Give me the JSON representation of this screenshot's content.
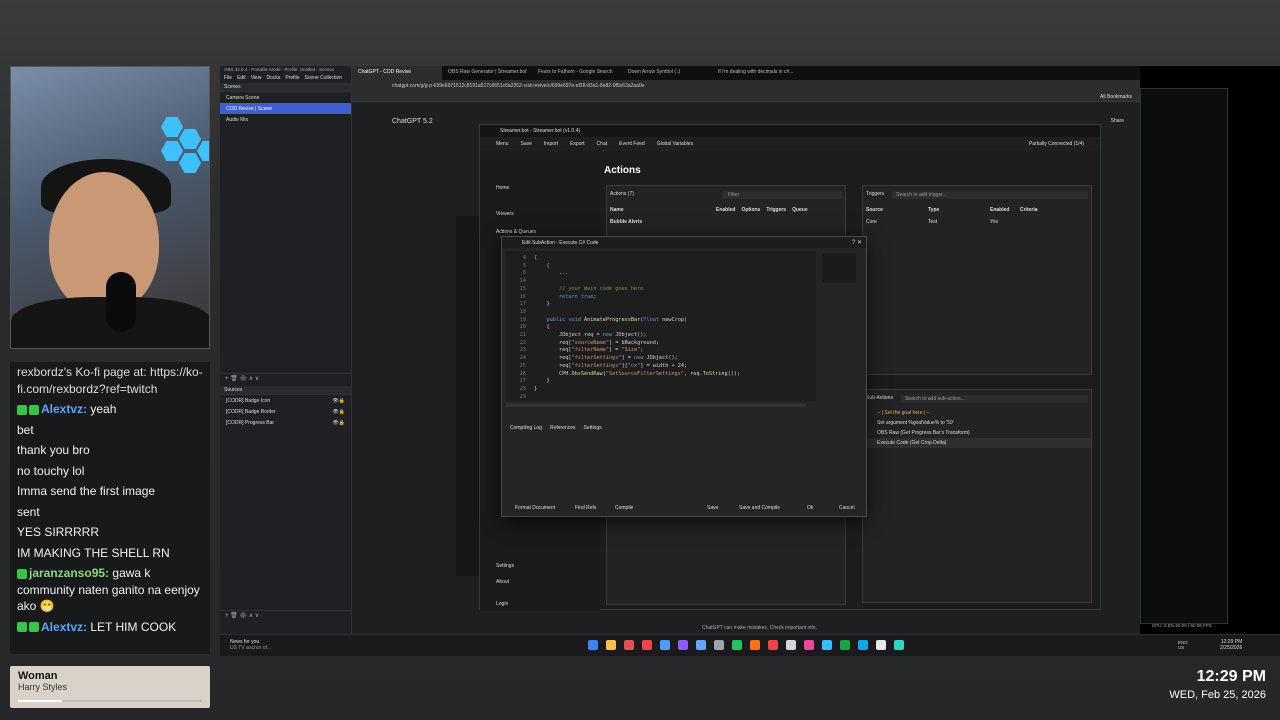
{
  "chat": {
    "messages": [
      {
        "user": "",
        "text": "rexbordz's Ko-fi page at: https://ko-fi.com/rexbordz?ref=twitch"
      },
      {
        "user": "Alextvz:",
        "text": "yeah"
      },
      {
        "user": "",
        "text": "bet"
      },
      {
        "user": "",
        "text": "thank you bro"
      },
      {
        "user": "",
        "text": "no touchy lol"
      },
      {
        "user": "",
        "text": "Imma send the first image"
      },
      {
        "user": "",
        "text": "sent"
      },
      {
        "user": "",
        "text": "YES SIRRRRR"
      },
      {
        "user": "",
        "text": "IM MAKING THE SHELL RN"
      },
      {
        "user": "jaranzanso95:",
        "text": "gawa k community naten ganito na eenjoy ako 😁"
      },
      {
        "user": "Alextvz:",
        "text": "LET HIM COOK"
      }
    ]
  },
  "now_playing": {
    "title": "Woman",
    "artist": "Harry Styles",
    "progress": 0.24
  },
  "clock": {
    "time": "12:29 PM",
    "date": "WED, Feb 25, 2026"
  },
  "obs": {
    "title": "OBS 32.0.4 - Portable Mode - Profile: Untitled - Scenes",
    "menu": [
      "File",
      "Edit",
      "View",
      "Docks",
      "Profile",
      "Scene Collection"
    ],
    "scenes_header": "Scenes",
    "scenes": [
      "Camera Scene",
      "COD Revive | Scene",
      "Audio Mix"
    ],
    "sources_header": "Sources",
    "sources": [
      "[CODR] Badge Icon",
      "[CODR] Badge Border",
      "[CODR] Progress Bar"
    ]
  },
  "browser": {
    "tabs": [
      "ChatGPT - COD Revive",
      "OBS Raw Generator | Streamer.bot",
      "Fears to Fathom - Google Search",
      "Down Arrow Symbol (↓)",
      "If i'm dealing with decimals in c#..."
    ],
    "url": "chatgpt.com/g/g-p-699e6971512c8191a517c6651c6a2352-cod-revive/c/699e697e-ef28-83a1-8e82-0f5c63a2aa0e",
    "bookmarks_label": "All Bookmarks",
    "share": "Share",
    "model": "ChatGPT 5.2",
    "disclaimer": "ChatGPT can make mistakes. Check important info."
  },
  "streamerbot": {
    "title": "Streamer.bot - Streamer.bot (v1.0.4)",
    "toolbar": [
      "Menu",
      "Save",
      "Import",
      "Export",
      "Chat",
      "Event Feed",
      "Global Variables"
    ],
    "status": "Partially Connected (1/4)",
    "nav": [
      "Home",
      "Viewers",
      "Actions & Queues",
      "Settings",
      "About",
      "Login"
    ],
    "page_title": "Actions",
    "actions_count": "Actions (7)",
    "filter_placeholder": "Filter",
    "action_columns": [
      "Name",
      "Enabled",
      "Options",
      "Triggers",
      "Queue"
    ],
    "action_group": "Bubble Alerts",
    "triggers_label": "Triggers",
    "triggers_search": "Search to add trigger...",
    "trigger_columns": [
      "Source",
      "Type",
      "Enabled",
      "Criteria"
    ],
    "trigger_row": [
      "Core",
      "Test",
      "Yes",
      ""
    ],
    "subactions_label": "Sub-Actions",
    "subactions_search": "Search to add sub-action...",
    "subactions": [
      "-- | Set the goal here | --",
      "Set argument %goalValue% to '50'",
      "OBS Raw (Get Progress Bar's Transform)",
      "Execute Code (Get Crop Delta)"
    ]
  },
  "dialog": {
    "title": "Edit SubAction - Execute C# Code",
    "tabs": [
      "Compiling Log",
      "References",
      "Settings"
    ],
    "buttons_left": [
      "Format Document",
      "Find Refs",
      "Compile"
    ],
    "buttons_right": [
      "Save",
      "Save and Compile",
      "Ok",
      "Cancel"
    ],
    "line_numbers": [
      "4",
      "5",
      "6",
      "",
      "14",
      "15",
      "16",
      "17",
      "18",
      "19",
      "20",
      "21",
      "22",
      "23",
      "24",
      "25",
      "26",
      "27",
      "28",
      "29"
    ]
  },
  "taskbar": {
    "news_title": "News for you",
    "news_sub": "US TV anchor of...",
    "stats": "CPU: 0.5%   60.00 / 60.00 FPS",
    "lang": "ENG US",
    "tray_time": "12:29 PM",
    "tray_date": "2/25/2026"
  }
}
